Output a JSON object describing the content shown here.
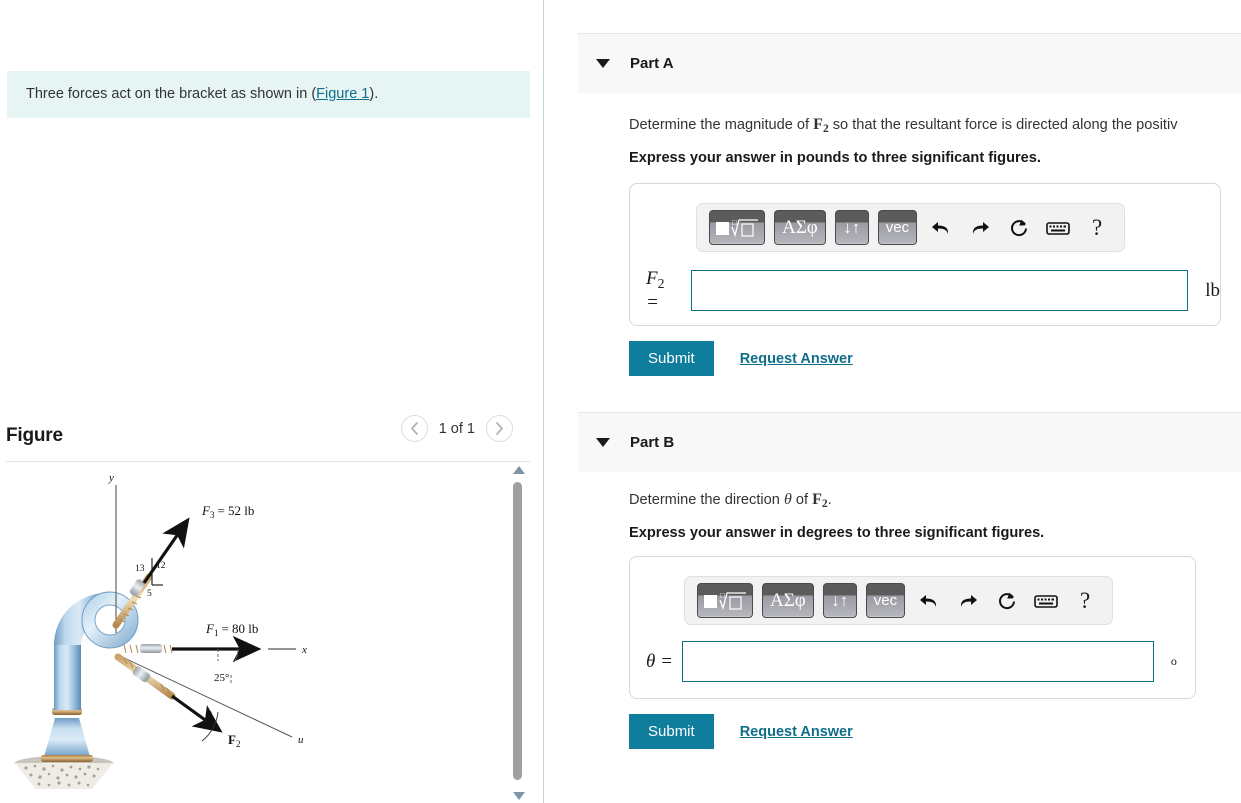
{
  "left": {
    "problem": {
      "text_before": "Three forces act on the bracket as shown in (",
      "link": "Figure 1",
      "text_after": ")."
    },
    "figure": {
      "title": "Figure",
      "prev_icon": "chevron-left-icon",
      "next_icon": "chevron-right-icon",
      "counter": "1 of 1"
    },
    "scrollbar": {
      "up_icon": "scroll-up-arrow-icon",
      "down_icon": "scroll-down-arrow-icon"
    }
  },
  "diagram": {
    "axis_y": "y",
    "axis_x": "x",
    "axis_u": "u",
    "f3_label": "F",
    "f3_sub": "3",
    "f3_value": "= 52 lb",
    "f1_label": "F",
    "f1_sub": "1",
    "f1_value": "= 80 lb",
    "f2_label": "F",
    "f2_sub": "2",
    "slope_hyp": "13",
    "slope_vert": "12",
    "slope_horiz": "5",
    "angle_25": "25°",
    "angle_theta": "θ"
  },
  "parts": [
    {
      "id": "part-a",
      "caret_icon": "caret-down-icon",
      "label": "Part A",
      "question_plain_1": "Determine the magnitude of ",
      "question_var": "F",
      "question_sub": "2",
      "question_plain_2": " so that the resultant force is directed along the positiv",
      "instruction": "Express your answer in pounds to three significant figures.",
      "toolbar": {
        "template_icon": "math-template-icon",
        "greek_label": "ΑΣφ",
        "arrows_label": "↓↑",
        "vec_label": "vec",
        "undo_icon": "undo-arrow-icon",
        "redo_icon": "redo-arrow-icon",
        "reset_icon": "reset-circular-arrow-icon",
        "keyboard_icon": "keyboard-icon",
        "help_icon": "question-mark-icon"
      },
      "answer": {
        "symbol": "F",
        "symbol_sub": "2",
        "equals": "=",
        "value": "",
        "unit": "lb"
      },
      "submit_label": "Submit",
      "request_label": "Request Answer"
    },
    {
      "id": "part-b",
      "caret_icon": "caret-down-icon",
      "label": "Part B",
      "question_plain_1": "Determine the direction ",
      "question_theta": "θ",
      "question_plain_mid": " of ",
      "question_var": "F",
      "question_sub": "2",
      "question_plain_2": ".",
      "instruction": "Express your answer in degrees to three significant figures.",
      "toolbar": {
        "template_icon": "math-template-icon",
        "greek_label": "ΑΣφ",
        "arrows_label": "↓↑",
        "vec_label": "vec",
        "undo_icon": "undo-arrow-icon",
        "redo_icon": "redo-arrow-icon",
        "reset_icon": "reset-circular-arrow-icon",
        "keyboard_icon": "keyboard-icon",
        "help_icon": "question-mark-icon"
      },
      "answer": {
        "symbol": "θ",
        "symbol_sub": "",
        "equals": "=",
        "value": "",
        "unit": "o"
      },
      "submit_label": "Submit",
      "request_label": "Request Answer"
    }
  ],
  "colors": {
    "accent_teal": "#0f7d9c",
    "link_teal": "#0f6f89",
    "statement_bg": "#e7f4f4",
    "header_bg": "#f8f8f8",
    "pipe_blue": "#9cc3e0"
  }
}
